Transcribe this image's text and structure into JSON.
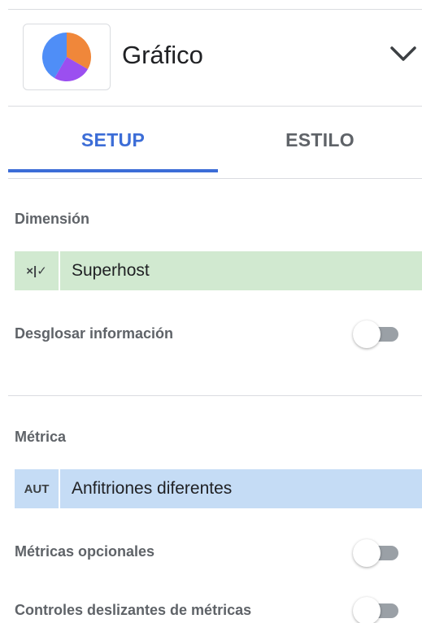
{
  "chart_picker": {
    "title": "Gráfico",
    "icon": "pie-chart-icon",
    "pie_colors": [
      "#4f8ef7",
      "#f0873a",
      "#9b4ff0"
    ]
  },
  "tabs": [
    {
      "label": "SETUP",
      "active": true
    },
    {
      "label": "ESTILO",
      "active": false
    }
  ],
  "dimension": {
    "section_label": "Dimensión",
    "chip_type": "×|✓",
    "chip_name": "Superhost",
    "breakdown_label": "Desglosar información",
    "breakdown_enabled": false
  },
  "metric": {
    "section_label": "Métrica",
    "chip_type": "AUT",
    "chip_name": "Anfitriones diferentes",
    "optional_label": "Métricas opcionales",
    "optional_enabled": false,
    "sliders_label": "Controles deslizantes de métricas",
    "sliders_enabled": false
  },
  "colors": {
    "accent": "#3c6dd7",
    "dimension_chip": "#d1e9d0",
    "metric_chip": "#c5dcf5"
  }
}
